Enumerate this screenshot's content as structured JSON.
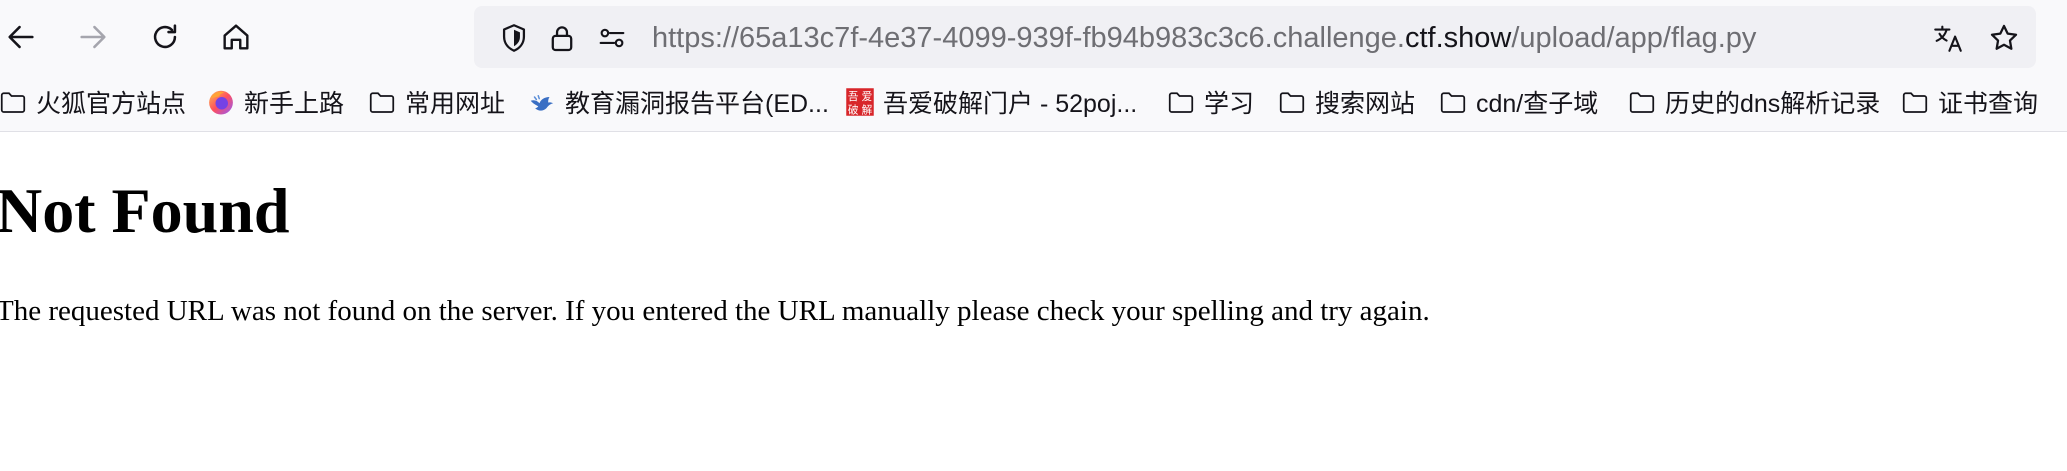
{
  "toolbar": {
    "url_prefix": "https://65a13c7f-4e37-4099-939f-fb94b983c3c6.challenge.",
    "url_domain": "ctf.show",
    "url_path": "/upload/app/flag.py"
  },
  "bookmarks": [
    {
      "label": "火狐官方站点",
      "icon": "folder-icon"
    },
    {
      "label": "新手上路",
      "icon": "firefox-icon"
    },
    {
      "label": "常用网址",
      "icon": "folder-icon"
    },
    {
      "label": "教育漏洞报告平台(ED...",
      "icon": "bird-icon"
    },
    {
      "label": "吾爱破解门户 - 52poj...",
      "icon": "52pojie-icon"
    },
    {
      "label": "学习",
      "icon": "folder-icon"
    },
    {
      "label": "搜索网站",
      "icon": "folder-icon"
    },
    {
      "label": "cdn/查子域",
      "icon": "folder-icon"
    },
    {
      "label": "历史的dns解析记录",
      "icon": "folder-icon"
    },
    {
      "label": "证书查询",
      "icon": "folder-icon"
    }
  ],
  "bookmark_logo_text": "吾爱破解",
  "page": {
    "heading": "Not Found",
    "message": "The requested URL was not found on the server. If you entered the URL manually please check your spelling and try again."
  }
}
